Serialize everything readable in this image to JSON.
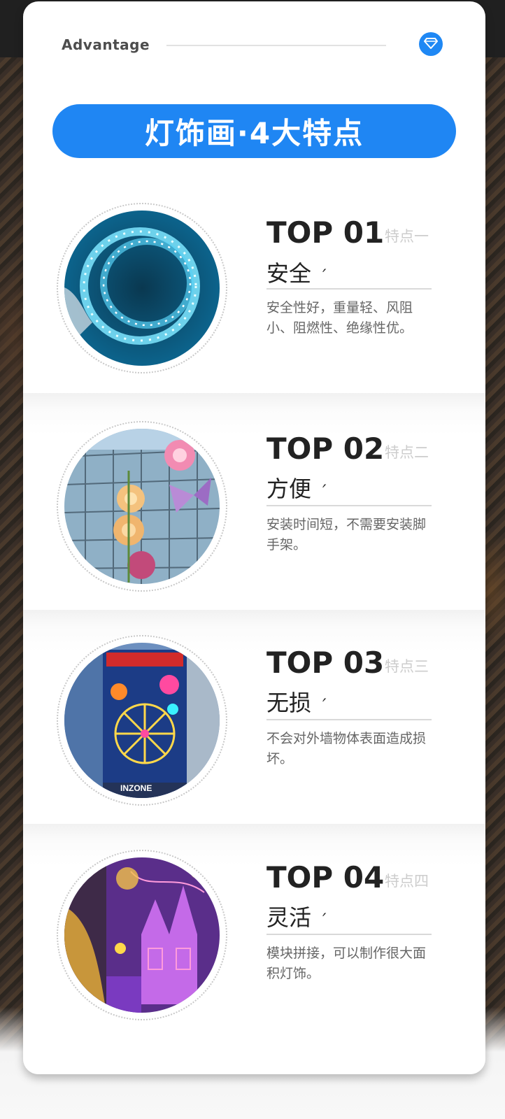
{
  "header": {
    "advantage_label": "Advantage",
    "gem_icon": "diamond-icon",
    "accent": "#1f86f3"
  },
  "banner": {
    "title": "灯饰画·4大特点"
  },
  "features": [
    {
      "top": "TOP 01",
      "tag": "特点一",
      "title": "安全",
      "mark": "′",
      "desc": "安全性好，重量轻、风阻小、阻燃性、绝缘性优。",
      "photo": "blue-rope-light-photo"
    },
    {
      "top": "TOP 02",
      "tag": "特点二",
      "title": "方便",
      "mark": "′",
      "desc": "安装时间短，不需要安装脚手架。",
      "photo": "flower-butterfly-wall-photo"
    },
    {
      "top": "TOP 03",
      "tag": "特点三",
      "title": "无损",
      "mark": "′",
      "desc": "不会对外墙物体表面造成损坏。",
      "photo": "ferris-wheel-building-photo"
    },
    {
      "top": "TOP 04",
      "tag": "特点四",
      "title": "灵活",
      "mark": "′",
      "desc": "模块拼接，可以制作很大面积灯饰。",
      "photo": "castle-light-installation-photo"
    }
  ],
  "photo_sign": "INZONE"
}
